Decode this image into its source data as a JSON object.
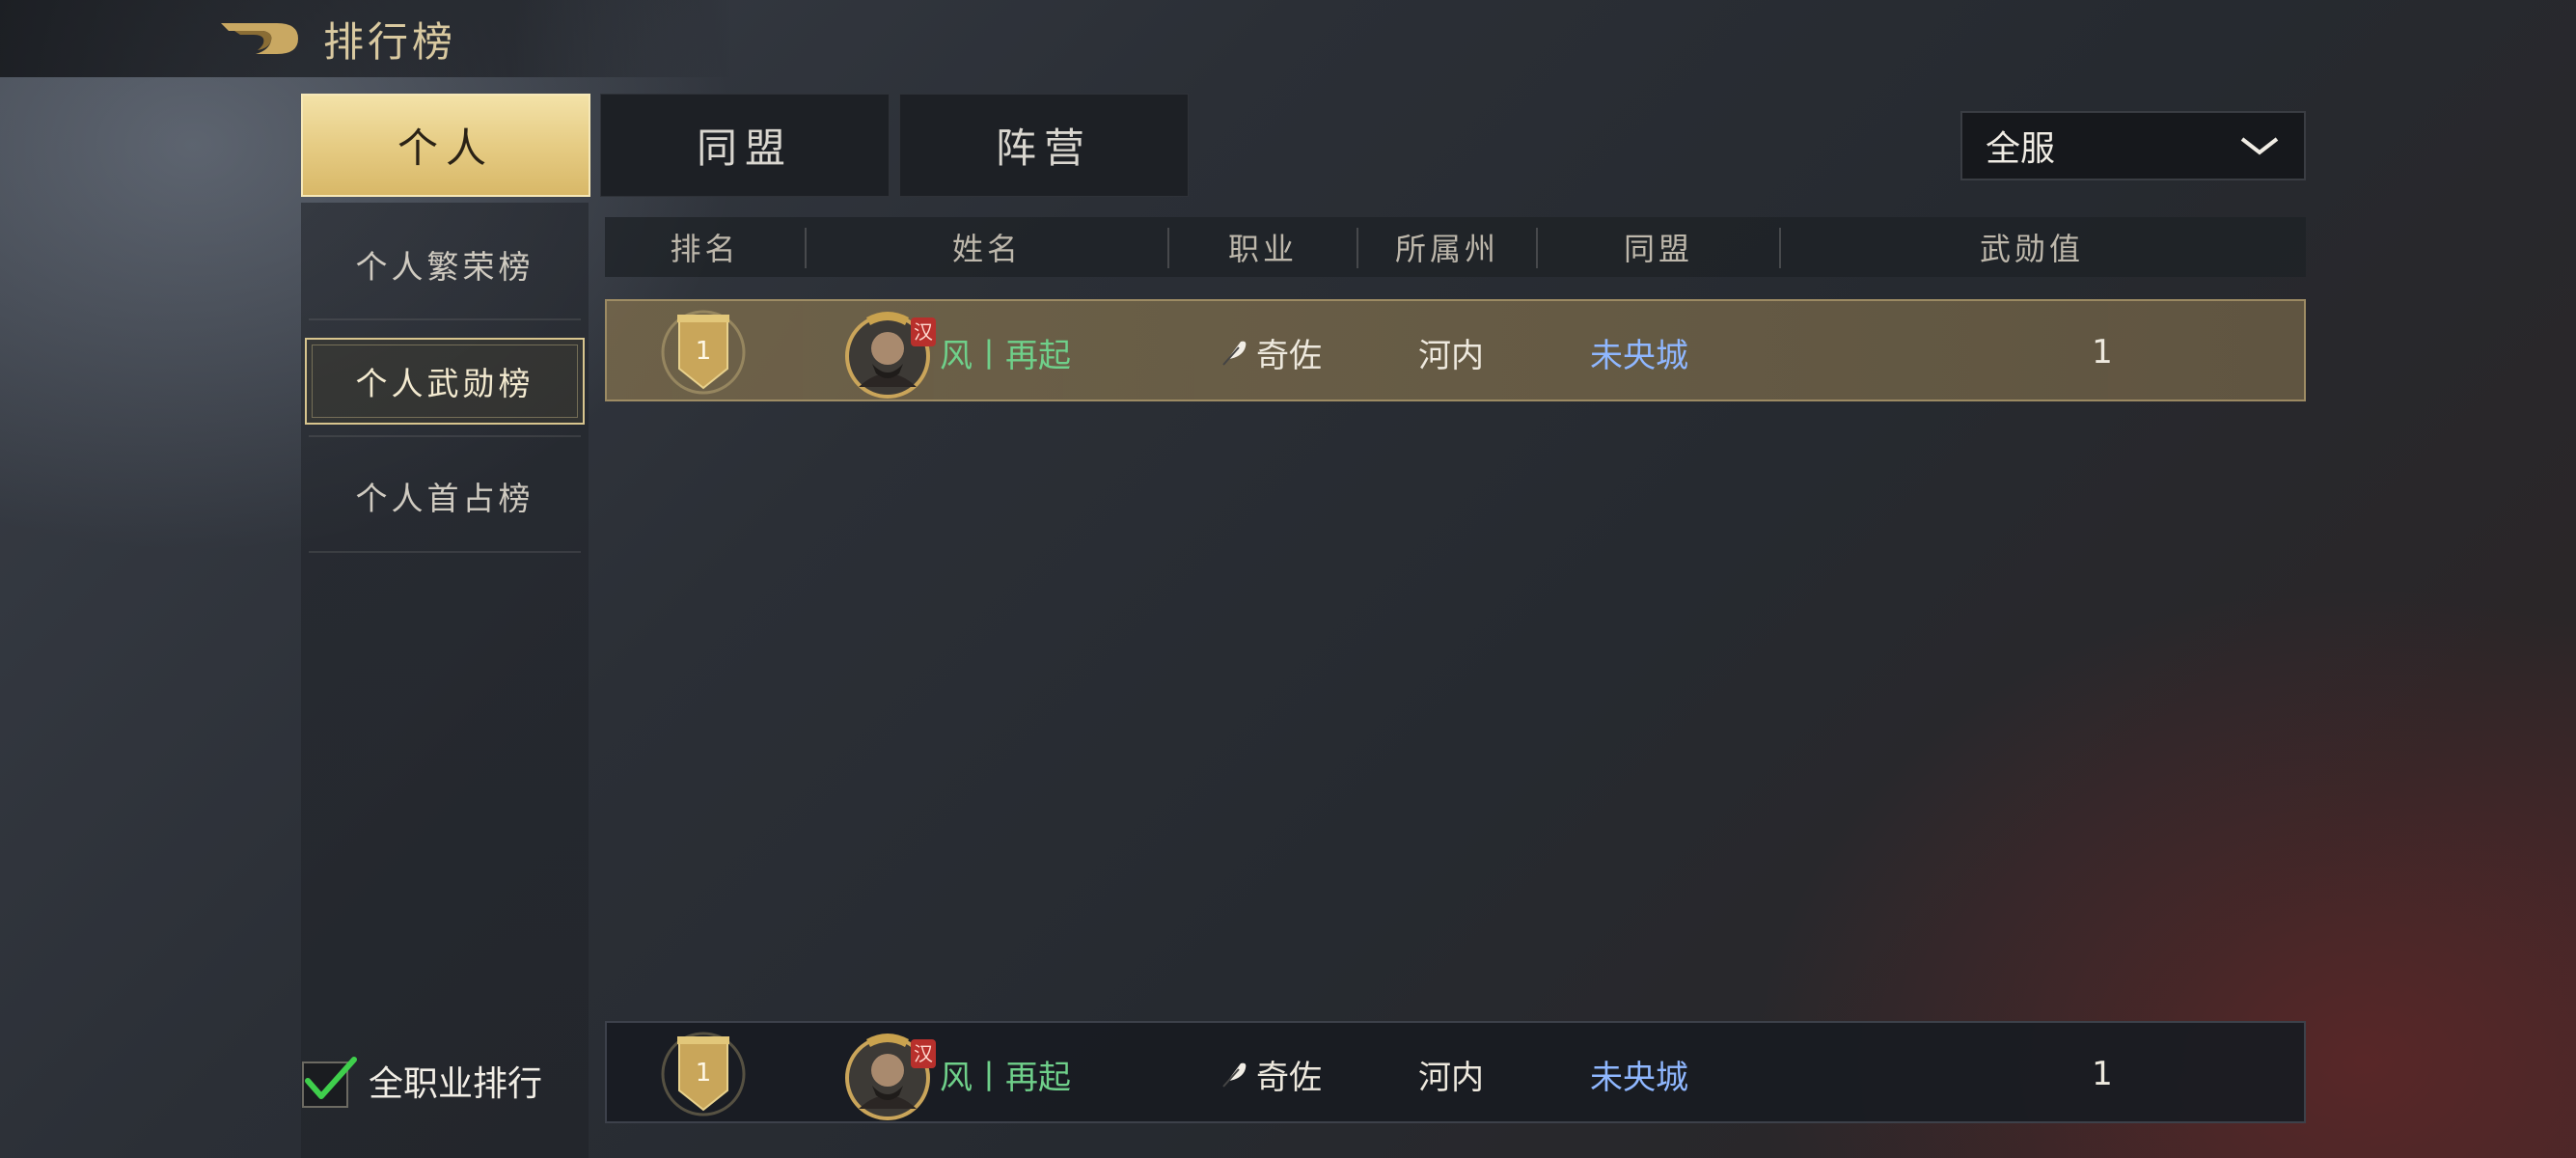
{
  "header": {
    "title": "排行榜"
  },
  "tabs": [
    {
      "label": "个人",
      "active": true
    },
    {
      "label": "同盟",
      "active": false
    },
    {
      "label": "阵营",
      "active": false
    }
  ],
  "server_filter": {
    "value": "全服"
  },
  "sidebar": {
    "items": [
      {
        "label": "个人繁荣榜",
        "active": false
      },
      {
        "label": "个人武勋榜",
        "active": true
      },
      {
        "label": "个人首占榜",
        "active": false
      }
    ]
  },
  "table": {
    "columns": [
      "排名",
      "姓名",
      "职业",
      "所属州",
      "同盟",
      "武勋值"
    ],
    "rows": [
      {
        "rank": "1",
        "faction": "汉",
        "name": "风丨再起",
        "job": "奇佐",
        "state": "河内",
        "alliance": "未央城",
        "score": "1"
      }
    ]
  },
  "my_row": {
    "rank": "1",
    "faction": "汉",
    "name": "风丨再起",
    "job": "奇佐",
    "state": "河内",
    "alliance": "未央城",
    "score": "1"
  },
  "footer": {
    "all_jobs_label": "全职业排行",
    "all_jobs_checked": true
  },
  "colors": {
    "gold_accent": "#e6cc84",
    "name_green": "#6fd08a",
    "alliance_blue": "#8fb7ff",
    "faction_red": "#b8302c"
  }
}
